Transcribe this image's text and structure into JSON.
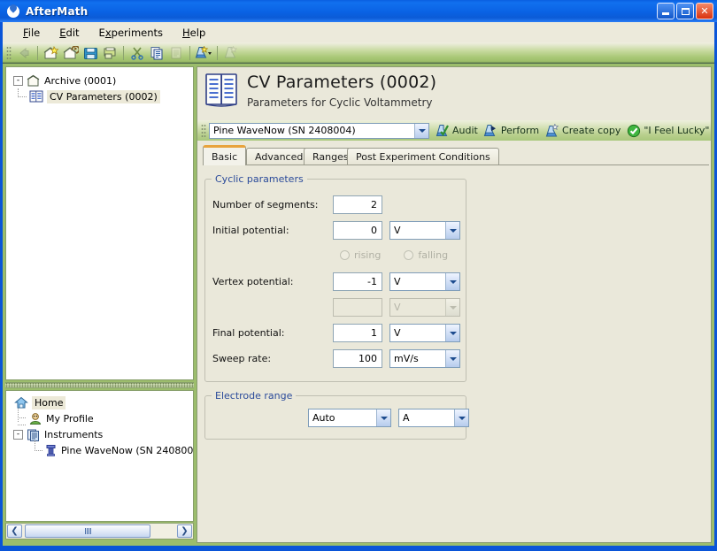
{
  "window": {
    "title": "AfterMath",
    "icon": "droplet-logo-icon",
    "buttons": {
      "minimize": "minimize-button",
      "maximize": "maximize-button",
      "close": "close-button"
    }
  },
  "menubar": {
    "items": [
      {
        "label": "File",
        "mnemonic": "F"
      },
      {
        "label": "Edit",
        "mnemonic": "E"
      },
      {
        "label": "Experiments",
        "mnemonic": "x"
      },
      {
        "label": "Help",
        "mnemonic": "H"
      }
    ]
  },
  "toolbar": {
    "buttons": [
      {
        "name": "back-icon",
        "tip": "Back",
        "disabled": true
      },
      {
        "name": "new-archive-icon",
        "tip": "New Archive",
        "disabled": false
      },
      {
        "name": "delete-archive-icon",
        "tip": "Delete",
        "disabled": false
      },
      {
        "name": "save-icon",
        "tip": "Save",
        "disabled": false
      },
      {
        "name": "print-icon",
        "tip": "Print",
        "disabled": false
      },
      {
        "name": "cut-icon",
        "tip": "Cut",
        "disabled": false
      },
      {
        "name": "copy-icon",
        "tip": "Copy",
        "disabled": false
      },
      {
        "name": "paste-icon",
        "tip": "Paste",
        "disabled": true
      },
      {
        "name": "new-experiment-icon",
        "tip": "New Experiment",
        "disabled": false
      },
      {
        "name": "create-copy-icon",
        "tip": "Create copy",
        "disabled": true
      }
    ]
  },
  "tree_top": {
    "nodes": [
      {
        "label": "Archive (0001)",
        "icon": "archive-icon",
        "depth": 0,
        "expander": "-",
        "selected": false
      },
      {
        "label": "CV Parameters (0002)",
        "icon": "parameters-book-icon",
        "depth": 1,
        "expander": "",
        "selected": true
      }
    ]
  },
  "tree_bottom": {
    "nodes": [
      {
        "label": "Home",
        "icon": "home-icon",
        "depth": 0,
        "expander": "",
        "selected": true
      },
      {
        "label": "My Profile",
        "icon": "profile-icon",
        "depth": 1,
        "expander": "",
        "selected": false
      },
      {
        "label": "Instruments",
        "icon": "instruments-icon",
        "depth": 1,
        "expander": "-",
        "selected": false
      },
      {
        "label": "Pine WaveNow (SN 240800",
        "icon": "device-icon",
        "depth": 2,
        "expander": "",
        "selected": false
      }
    ]
  },
  "scrollbar": {
    "left_arrow": "❮",
    "right_arrow": "❯"
  },
  "document": {
    "icon": "open-book-icon",
    "title": "CV Parameters (0002)",
    "subtitle": "Parameters for Cyclic Voltammetry"
  },
  "instrument_bar": {
    "selected_instrument": "Pine WaveNow (SN 2408004)",
    "commands": [
      {
        "label": "Audit",
        "icon": "audit-flask-icon"
      },
      {
        "label": "Perform",
        "icon": "perform-flask-icon"
      },
      {
        "label": "Create copy",
        "icon": "copy-flask-icon"
      },
      {
        "label": "\"I Feel Lucky\"",
        "icon": "green-check-icon"
      }
    ]
  },
  "tabs": [
    {
      "label": "Basic",
      "active": true
    },
    {
      "label": "Advanced",
      "active": false
    },
    {
      "label": "Ranges",
      "active": false
    },
    {
      "label": "Post Experiment Conditions",
      "active": false
    }
  ],
  "cyclic_parameters": {
    "title": "Cyclic parameters",
    "fields": [
      {
        "label": "Number of segments:",
        "value": "2",
        "unit": null,
        "disabled": false
      },
      {
        "label": "Initial potential:",
        "value": "0",
        "unit": "V",
        "disabled": false
      },
      {
        "label": "Vertex potential:",
        "value": "-1",
        "unit": "V",
        "disabled": false
      },
      {
        "label": "",
        "value": "",
        "unit": "V",
        "disabled": true
      },
      {
        "label": "Final potential:",
        "value": "1",
        "unit": "V",
        "disabled": false
      },
      {
        "label": "Sweep rate:",
        "value": "100",
        "unit": "mV/s",
        "disabled": false
      }
    ],
    "direction_options": [
      {
        "label": "rising",
        "selected": false,
        "disabled": true
      },
      {
        "label": "falling",
        "selected": false,
        "disabled": true
      }
    ]
  },
  "electrode_range": {
    "title": "Electrode range",
    "range_value": "Auto",
    "unit_value": "A"
  },
  "colors": {
    "titlebar_blue": "#0a62e4",
    "toolbar_green": "#a9c877",
    "page_background": "#eae8da",
    "group_title_blue": "#2a4a9a",
    "active_tab_accent": "#e8a33d",
    "selection": "#ece9d8"
  }
}
